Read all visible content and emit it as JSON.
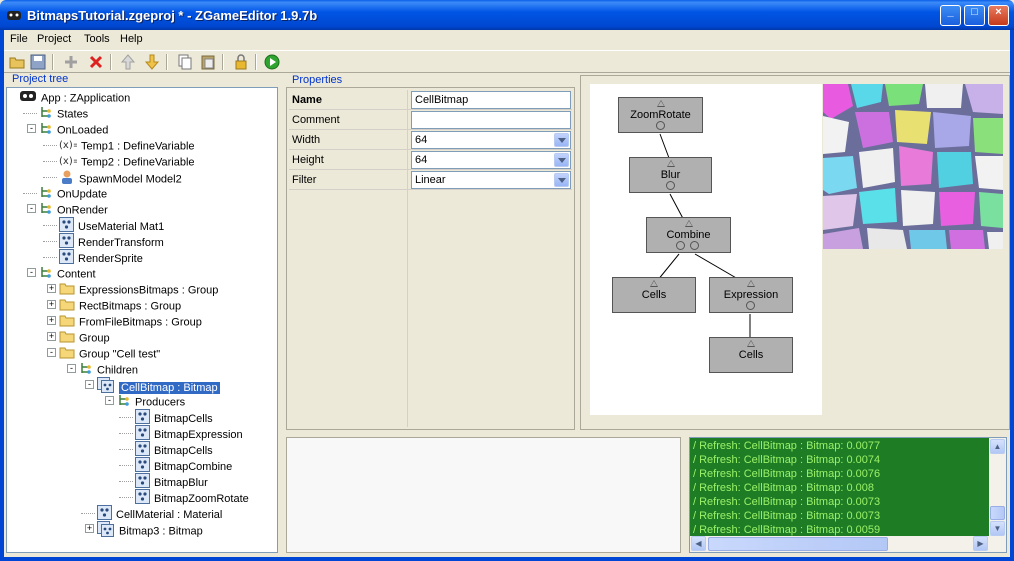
{
  "window": {
    "title": "BitmapsTutorial.zgeproj * - ZGameEditor 1.9.7b",
    "controls": [
      "_",
      "□",
      "×"
    ]
  },
  "menu": [
    "File",
    "Project",
    "Tools",
    "Help"
  ],
  "toolbar": [
    "open-folder-icon",
    "save-icon",
    "add-icon",
    "delete-icon",
    "move-up-icon",
    "move-down-icon",
    "copy-icon",
    "paste-icon",
    "lock-icon",
    "run-icon"
  ],
  "tree": {
    "label": "Project tree",
    "items": [
      {
        "text": "App : ZApplication",
        "icon": "app-icon"
      },
      {
        "text": "States",
        "icon": "list-icon"
      },
      {
        "text": "OnLoaded",
        "icon": "list-icon"
      },
      {
        "text": "Temp1 : DefineVariable",
        "icon": "variable-icon"
      },
      {
        "text": "Temp2 : DefineVariable",
        "icon": "variable-icon"
      },
      {
        "text": "SpawnModel  Model2",
        "icon": "spawn-icon"
      },
      {
        "text": "OnUpdate",
        "icon": "list-icon"
      },
      {
        "text": "OnRender",
        "icon": "list-icon"
      },
      {
        "text": "UseMaterial  Mat1",
        "icon": "component-icon"
      },
      {
        "text": "RenderTransform",
        "icon": "component-icon"
      },
      {
        "text": "RenderSprite",
        "icon": "component-icon"
      },
      {
        "text": "Content",
        "icon": "list-icon"
      },
      {
        "text": "ExpressionsBitmaps : Group",
        "icon": "folder-icon"
      },
      {
        "text": "RectBitmaps : Group",
        "icon": "folder-icon"
      },
      {
        "text": "FromFileBitmaps : Group",
        "icon": "folder-icon"
      },
      {
        "text": "Group",
        "icon": "folder-icon"
      },
      {
        "text": "Group \"Cell test\"",
        "icon": "folder-icon"
      },
      {
        "text": "Children",
        "icon": "list-icon"
      },
      {
        "text": "CellBitmap : Bitmap",
        "icon": "bitmap-icon"
      },
      {
        "text": "Producers",
        "icon": "list-icon"
      },
      {
        "text": "BitmapCells",
        "icon": "component-icon"
      },
      {
        "text": "BitmapExpression",
        "icon": "component-icon"
      },
      {
        "text": "BitmapCells",
        "icon": "component-icon"
      },
      {
        "text": "BitmapCombine",
        "icon": "component-icon"
      },
      {
        "text": "BitmapBlur",
        "icon": "component-icon"
      },
      {
        "text": "BitmapZoomRotate",
        "icon": "component-icon"
      },
      {
        "text": "CellMaterial : Material",
        "icon": "component-icon"
      },
      {
        "text": "Bitmap3 : Bitmap",
        "icon": "bitmap-icon"
      }
    ]
  },
  "properties": {
    "label": "Properties",
    "rows": [
      {
        "name": "Name",
        "value": "CellBitmap",
        "type": "text"
      },
      {
        "name": "Comment",
        "value": "",
        "type": "text"
      },
      {
        "name": "Width",
        "value": "64",
        "type": "combo"
      },
      {
        "name": "Height",
        "value": "64",
        "type": "combo"
      },
      {
        "name": "Filter",
        "value": "Linear",
        "type": "combo"
      }
    ]
  },
  "graph": {
    "nodes": [
      "ZoomRotate",
      "Blur",
      "Combine",
      "Cells",
      "Expression",
      "Cells"
    ]
  },
  "log": {
    "lines": [
      "/  Refresh: CellBitmap : Bitmap: 0.0077",
      "/  Refresh: CellBitmap : Bitmap: 0.0074",
      "/  Refresh: CellBitmap : Bitmap: 0.0076",
      "/  Refresh: CellBitmap : Bitmap: 0.008",
      "/  Refresh: CellBitmap : Bitmap: 0.0073",
      "/  Refresh: CellBitmap : Bitmap: 0.0073",
      "/  Refresh: CellBitmap : Bitmap: 0.0059"
    ]
  }
}
